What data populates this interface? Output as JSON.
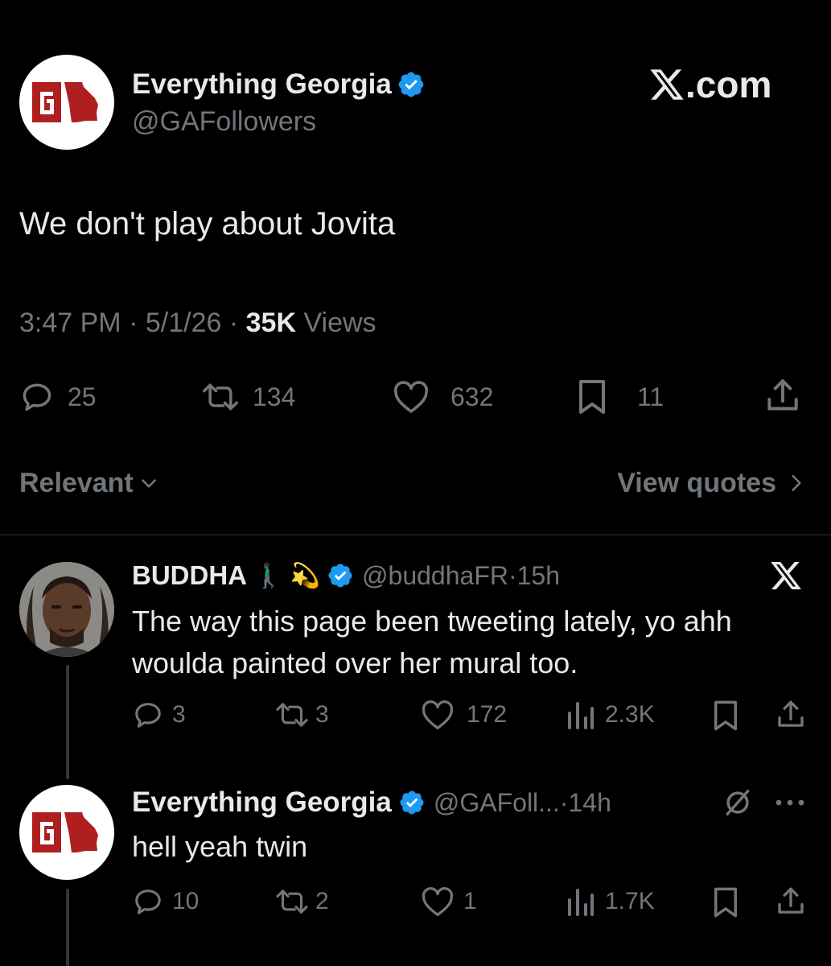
{
  "main_post": {
    "display_name": "Everything Georgia",
    "handle": "@GAFollowers",
    "brand": "X.com",
    "text": "We don't play about Jovita",
    "time": "3:47 PM",
    "date": "5/1/26",
    "views_count": "35K",
    "views_label": "Views",
    "replies": "25",
    "reposts": "134",
    "likes": "632",
    "bookmarks": "11"
  },
  "filter_bar": {
    "sort_label": "Relevant",
    "quotes_label": "View quotes"
  },
  "reply1": {
    "display_name": "BUDDHA",
    "name_emojis": "🚶🏿‍♂️ 💫",
    "handle": "@buddhaFR",
    "time": "15h",
    "text_line1": "The way this page been tweeting lately, yo ahh",
    "text_line2": "woulda painted over her mural too.",
    "replies": "3",
    "reposts": "3",
    "likes": "172",
    "views": "2.3K"
  },
  "reply2": {
    "display_name": "Everything Georgia",
    "handle": "@GAFoll...",
    "time": "14h",
    "text": "hell yeah twin",
    "replies": "10",
    "reposts": "2",
    "likes": "1",
    "views": "1.7K"
  },
  "colors": {
    "background": "#000000",
    "text": "#e7e9ea",
    "muted": "#71767b",
    "verified_blue": "#1d9bf0",
    "logo_red": "#b01f1f",
    "divider": "#2f3336"
  },
  "icons": [
    "verified-badge-icon",
    "x-logo-icon",
    "reply-icon",
    "repost-icon",
    "like-icon",
    "bookmark-icon",
    "share-icon",
    "chevron-down-icon",
    "chevron-right-icon",
    "views-icon",
    "grok-icon",
    "more-icon"
  ]
}
